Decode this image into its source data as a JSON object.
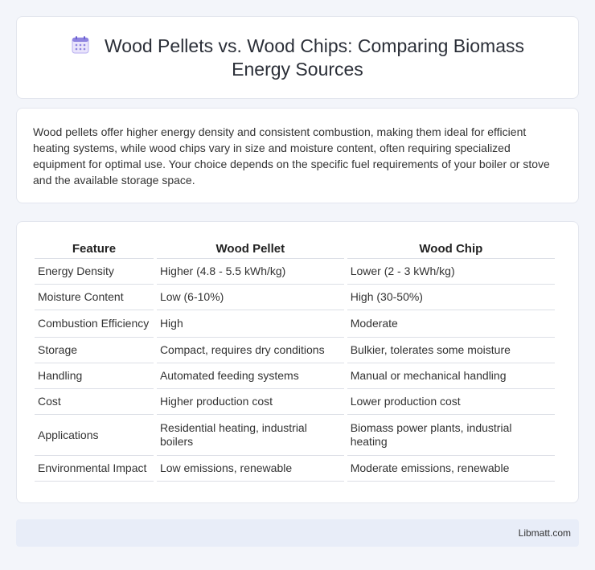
{
  "header": {
    "icon": "calendar-icon",
    "title": "Wood Pellets vs. Wood Chips: Comparing Biomass Energy Sources"
  },
  "intro": {
    "text": "Wood pellets offer higher energy density and consistent combustion, making them ideal for efficient heating systems, while wood chips vary in size and moisture content, often requiring specialized equipment for optimal use. Your choice depends on the specific fuel requirements of your boiler or stove and the available storage space."
  },
  "table": {
    "headers": [
      "Feature",
      "Wood Pellet",
      "Wood Chip"
    ],
    "rows": [
      [
        "Energy Density",
        "Higher (4.8 - 5.5 kWh/kg)",
        "Lower (2 - 3 kWh/kg)"
      ],
      [
        "Moisture Content",
        "Low (6-10%)",
        "High (30-50%)"
      ],
      [
        "Combustion Efficiency",
        "High",
        "Moderate"
      ],
      [
        "Storage",
        "Compact, requires dry conditions",
        "Bulkier, tolerates some moisture"
      ],
      [
        "Handling",
        "Automated feeding systems",
        "Manual or mechanical handling"
      ],
      [
        "Cost",
        "Higher production cost",
        "Lower production cost"
      ],
      [
        "Applications",
        "Residential heating, industrial boilers",
        "Biomass power plants, industrial heating"
      ],
      [
        "Environmental Impact",
        "Low emissions, renewable",
        "Moderate emissions, renewable"
      ]
    ]
  },
  "footer": {
    "brand": "Libmatt.com"
  },
  "colors": {
    "background": "#f3f5fa",
    "card": "#ffffff",
    "footer_bg": "#e8edf8",
    "icon_accent": "#7b6fd6"
  }
}
